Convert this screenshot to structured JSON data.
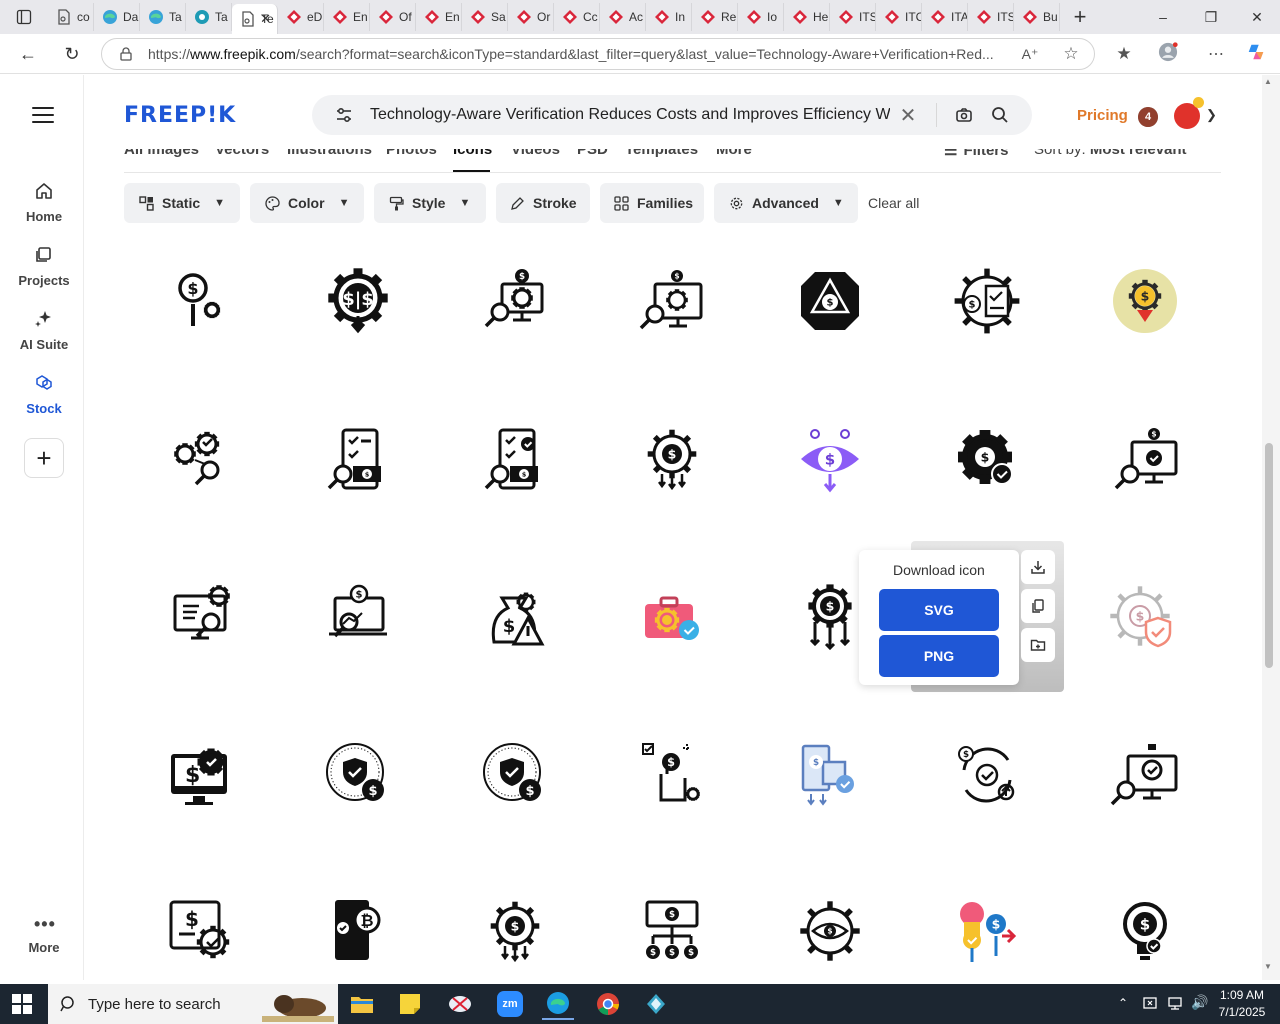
{
  "browser": {
    "tabs": [
      {
        "label": "co",
        "kind": "doc"
      },
      {
        "label": "Da",
        "kind": "edge"
      },
      {
        "label": "Ta",
        "kind": "edge"
      },
      {
        "label": "Ta",
        "kind": "teal"
      },
      {
        "label": "Te",
        "kind": "doc",
        "active": true
      },
      {
        "label": "eD",
        "kind": "red"
      },
      {
        "label": "En",
        "kind": "red"
      },
      {
        "label": "Of",
        "kind": "red"
      },
      {
        "label": "En",
        "kind": "red"
      },
      {
        "label": "Sa",
        "kind": "red"
      },
      {
        "label": "Or",
        "kind": "red"
      },
      {
        "label": "Cc",
        "kind": "red"
      },
      {
        "label": "Ac",
        "kind": "red"
      },
      {
        "label": "In",
        "kind": "red"
      },
      {
        "label": "Re",
        "kind": "red"
      },
      {
        "label": "Io",
        "kind": "red"
      },
      {
        "label": "He",
        "kind": "red"
      },
      {
        "label": "ITS",
        "kind": "red"
      },
      {
        "label": "ITC",
        "kind": "red"
      },
      {
        "label": "ITA",
        "kind": "red"
      },
      {
        "label": "ITS",
        "kind": "red"
      },
      {
        "label": "Bu",
        "kind": "red"
      }
    ],
    "url_prefix": "https://",
    "url_domain": "www.freepik.com",
    "url_rest": "/search?format=search&iconType=standard&last_filter=query&last_value=Technology-Aware+Verification+Red..."
  },
  "sidebar": {
    "items": [
      {
        "label": "Home",
        "icon": "home-icon"
      },
      {
        "label": "Projects",
        "icon": "projects-icon"
      },
      {
        "label": "AI Suite",
        "icon": "sparkle-icon"
      },
      {
        "label": "Stock",
        "icon": "stock-icon",
        "active": true
      }
    ],
    "more_label": "More"
  },
  "header": {
    "logo": "FREEP!K",
    "search_query": "Technology-Aware Verification Reduces Costs and Improves Efficiency W",
    "pricing_label": "Pricing",
    "notification_count": "4"
  },
  "subtabs": [
    "All images",
    "Vectors",
    "Illustrations",
    "Photos",
    "Icons",
    "Videos",
    "PSD",
    "Templates",
    "More"
  ],
  "subtab_active": "Icons",
  "filters_label": "Filters",
  "sort_label": "Sort by:",
  "sort_value": "Most relevant",
  "filters": [
    {
      "label": "Static",
      "icon": "static-icon",
      "dropdown": true
    },
    {
      "label": "Color",
      "icon": "palette-icon",
      "dropdown": true
    },
    {
      "label": "Style",
      "icon": "brush-icon",
      "dropdown": true
    },
    {
      "label": "Stroke",
      "icon": "pen-icon",
      "dropdown": false
    },
    {
      "label": "Families",
      "icon": "grid-icon",
      "dropdown": false
    },
    {
      "label": "Advanced",
      "icon": "gear-icon",
      "dropdown": true
    }
  ],
  "clear_all": "Clear all",
  "popup": {
    "title": "Download icon",
    "svg_label": "SVG",
    "png_label": "PNG"
  },
  "grid_icons": [
    [
      "dollar-search-gear-icon",
      "gear-dollar-icon",
      "monitor-moneybag-search-icon",
      "monitor-moneybag-gear-icon",
      "octagon-dollar-triangle-icon",
      "gear-document-dollar-icon",
      "dollar-badge-icon"
    ],
    [
      "gears-search-icon",
      "checklist-money-icon",
      "checklist-money-search-icon",
      "gear-dollar-arrows-icon",
      "eye-dollar-icon",
      "gear-dollar-check-icon",
      "monitor-moneybag-check-icon"
    ],
    [
      "monitor-gear-growth-icon",
      "laptop-money-growth-icon",
      "moneybag-warning-icon",
      "briefcase-gear-check-icon",
      "gear-dollar-arrows-down-icon",
      "",
      "gear-dollar-shield-icon"
    ],
    [
      "monitor-dollar-gear-icon",
      "dial-shield-dollar-icon",
      "dial-shield-dollar-icon",
      "hand-dollar-checklist-icon",
      "money-machine-check-icon",
      "cycle-check-icon",
      "monitor-check-search-icon"
    ],
    [
      "document-dollar-gear-icon",
      "phone-bitcoin-search-icon",
      "gear-dollar-arrows-icon",
      "banknote-flow-icon",
      "gear-eye-icon",
      "money-exchange-check-icon",
      "lightbulb-dollar-icon"
    ]
  ],
  "taskbar": {
    "search_placeholder": "Type here to search",
    "time": "1:09 AM",
    "date": "7/1/2025"
  },
  "colors": {
    "brand_blue": "#1f57d6",
    "pricing_orange": "#e0792a"
  }
}
